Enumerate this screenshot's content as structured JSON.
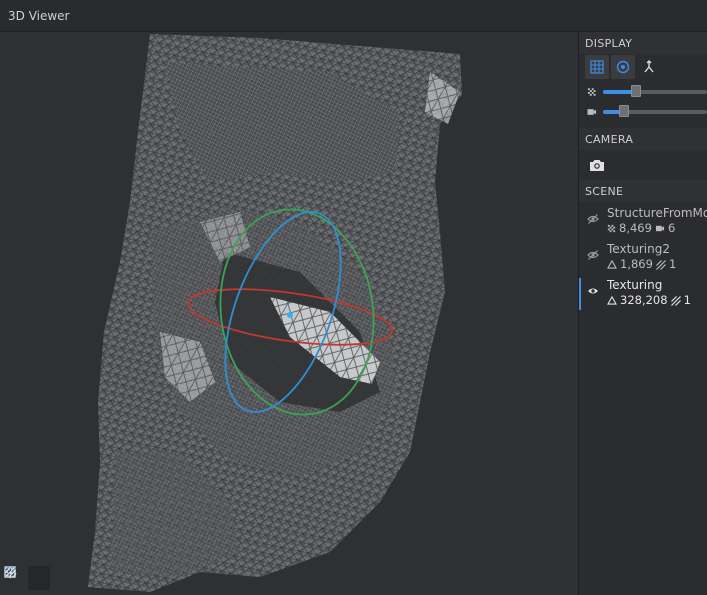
{
  "window": {
    "title": "3D Viewer"
  },
  "display": {
    "title": "DISPLAY",
    "buttons": [
      {
        "icon": "grid-icon",
        "active": true
      },
      {
        "icon": "target-icon",
        "active": false
      },
      {
        "icon": "split-icon",
        "active": false
      }
    ],
    "point_size_level": 0.3,
    "camera_scale_level": 0.15
  },
  "camera": {
    "title": "CAMERA",
    "button_icon": "camera-icon"
  },
  "scene": {
    "title": "SCENE",
    "items": [
      {
        "name": "StructureFromMotion",
        "visible": false,
        "stat1": "8,469",
        "stat1_icon": "points-icon",
        "stat2": "6",
        "stat2_icon": "camera-small-icon"
      },
      {
        "name": "Texturing2",
        "visible": false,
        "stat1": "1,869",
        "stat1_icon": "triangle-icon",
        "stat2": "1",
        "stat2_icon": "texture-icon"
      },
      {
        "name": "Texturing",
        "visible": true,
        "stat1": "328,208",
        "stat1_icon": "triangle-icon",
        "stat2": "1",
        "stat2_icon": "texture-icon"
      }
    ]
  },
  "viewport_toolbar": [
    {
      "icon": "solid-square-icon",
      "active": false
    },
    {
      "icon": "wireframe-triangle-icon",
      "active": true
    },
    {
      "icon": "texture-hatch-icon",
      "active": false
    },
    {
      "icon": "settings-gear-icon",
      "active": false
    }
  ],
  "colors": {
    "accent": "#3d8fe6",
    "gizmo_x": "#c0392b",
    "gizmo_y": "#3aa357",
    "gizmo_z": "#2f8fd0",
    "mesh": "#d9d9d9"
  }
}
